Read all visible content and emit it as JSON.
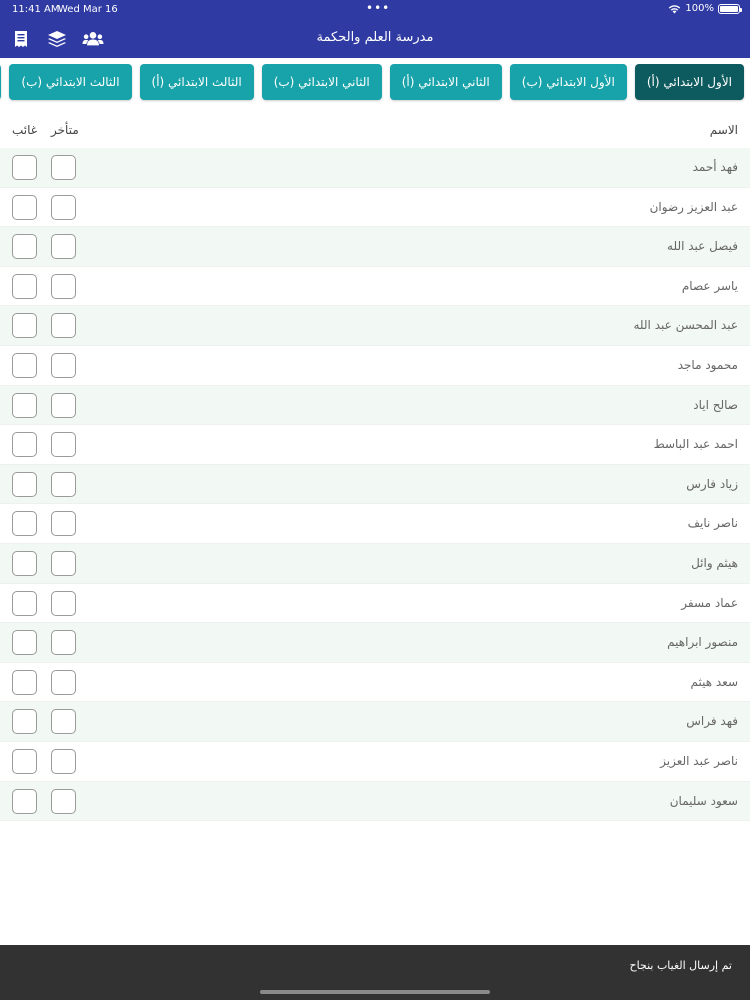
{
  "status_bar": {
    "time": "11:41 AM",
    "date": "Wed Mar 16",
    "dots": "•••",
    "battery": "100%"
  },
  "header": {
    "title": "مدرسة العلم والحكمة"
  },
  "nav_icons": [
    "receipt-icon",
    "layers-icon",
    "users-icon"
  ],
  "tabs": [
    {
      "label": "الأول الابتدائي (أ)",
      "active": true
    },
    {
      "label": "الأول الابتدائي (ب)",
      "active": false
    },
    {
      "label": "الثاني الابتدائي (أ)",
      "active": false
    },
    {
      "label": "الثاني الابتدائي (ب)",
      "active": false
    },
    {
      "label": "الثالث الابتدائي (أ)",
      "active": false
    },
    {
      "label": "الثالث الابتدائي (ب)",
      "active": false
    }
  ],
  "columns": {
    "name": "الاسم",
    "late": "متأخر",
    "absent": "غائب"
  },
  "students": [
    "فهد أحمد",
    "عبد العزيز رضوان",
    "فيصل عبد الله",
    "ياسر عصام",
    "عبد المحسن عبد الله",
    "محمود ماجد",
    "صالح اياد",
    "احمد عبد الباسط",
    "زياد فارس",
    "ناصر نايف",
    "هيثم وائل",
    "عماد مسفر",
    "منصور ابراهيم",
    "سعد هيثم",
    "فهد فراس",
    "ناصر عبد العزيز",
    "سعود سليمان"
  ],
  "toast": {
    "message": "تم إرسال الغياب بنجاح"
  },
  "colors": {
    "primary": "#2f3aa3",
    "tab": "#17a3a9",
    "tab_active": "#0e5b5f",
    "row_alt": "#f2f8f4"
  }
}
